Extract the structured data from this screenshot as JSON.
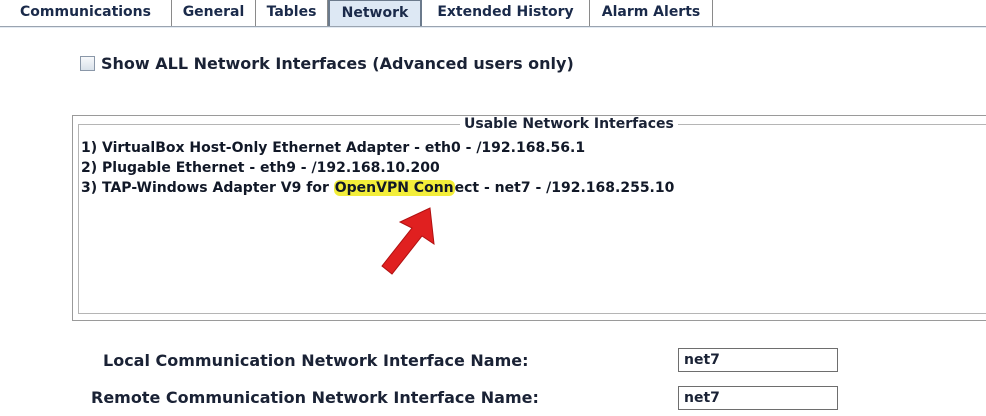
{
  "tabs": [
    {
      "label": "Communications"
    },
    {
      "label": "General"
    },
    {
      "label": "Tables"
    },
    {
      "label": "Network",
      "active": true
    },
    {
      "label": "Extended History"
    },
    {
      "label": "Alarm Alerts"
    }
  ],
  "show_all": {
    "label": "Show ALL Network Interfaces (Advanced users only)",
    "checked": false
  },
  "interfaces": {
    "title": "Usable Network Interfaces",
    "items": [
      {
        "text": "1) VirtualBox Host-Only Ethernet Adapter  - eth0 - /192.168.56.1"
      },
      {
        "text": "2) Plugable Ethernet  - eth9 - /192.168.10.200"
      },
      {
        "prefix": "3) TAP-Windows Adapter V9 for ",
        "highlight": "OpenVPN Conn",
        "suffix": "ect  - net7 - /192.168.255.10"
      }
    ]
  },
  "annotation": {
    "arrow_color": "#e02020",
    "highlight_color": "#f3ee3a"
  },
  "fields": {
    "local_label": "Local Communication Network Interface Name:",
    "local_value": "net7",
    "remote_label": "Remote Communication Network Interface Name:",
    "remote_value": "net7"
  }
}
